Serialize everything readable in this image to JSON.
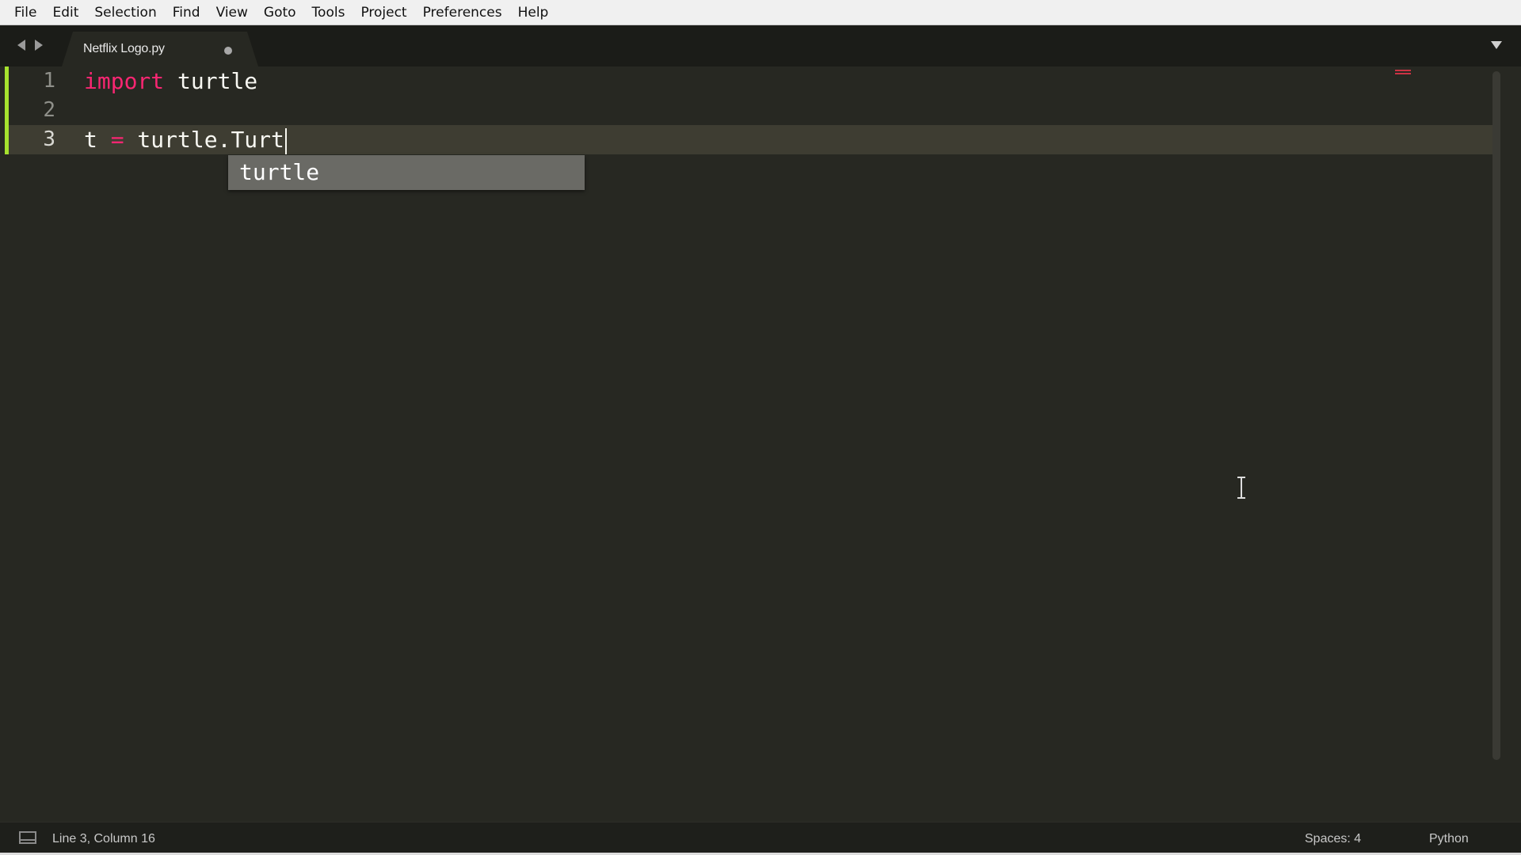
{
  "menubar": {
    "items": [
      "File",
      "Edit",
      "Selection",
      "Find",
      "View",
      "Goto",
      "Tools",
      "Project",
      "Preferences",
      "Help"
    ]
  },
  "tabs": {
    "active_tab_label": "Netflix Logo.py",
    "dirty_indicator": "unsaved-dot-icon"
  },
  "editor": {
    "lines": [
      {
        "number": "1",
        "keyword": "import",
        "rest": " turtle"
      },
      {
        "number": "2",
        "keyword": "",
        "rest": ""
      },
      {
        "number": "3",
        "before_op": "t ",
        "operator": "=",
        "after_op": " turtle.Turt"
      }
    ],
    "active_line": 3,
    "autocomplete": {
      "items": [
        "turtle"
      ]
    },
    "colors": {
      "background": "#272822",
      "keyword": "#f92672",
      "text": "#f8f8f2",
      "modified_line_marker": "#a6e22e"
    }
  },
  "statusbar": {
    "position": "Line 3, Column 16",
    "indentation": "Spaces: 4",
    "syntax": "Python"
  }
}
